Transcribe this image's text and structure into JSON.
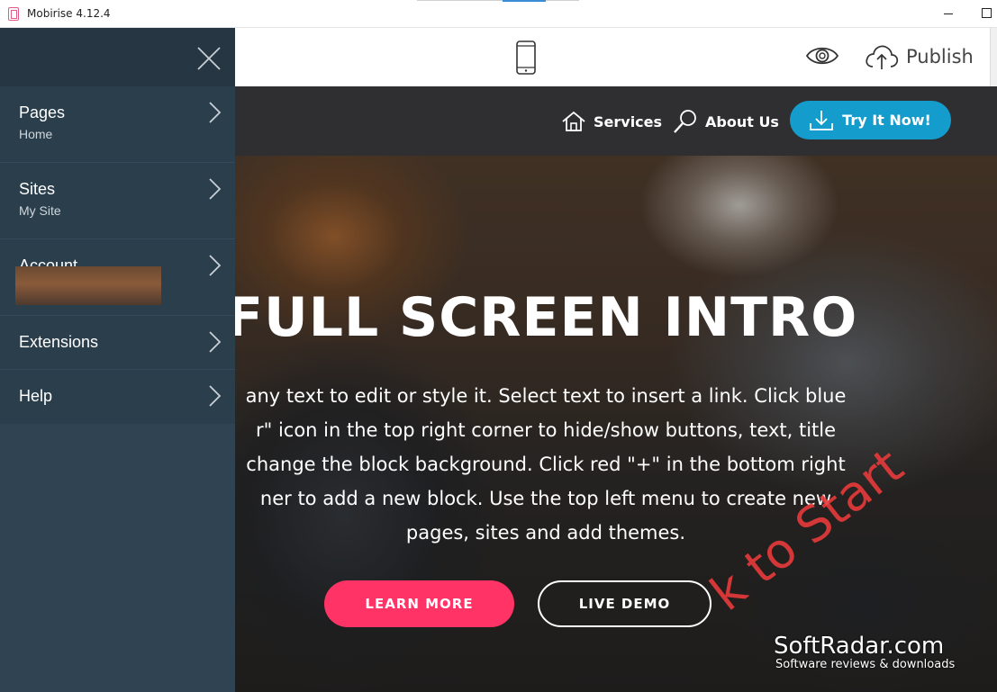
{
  "window": {
    "title": "Mobirise 4.12.4"
  },
  "toolbar": {
    "publish_label": "Publish"
  },
  "sidebar": {
    "items": [
      {
        "label": "Pages",
        "sub": "Home"
      },
      {
        "label": "Sites",
        "sub": "My Site"
      },
      {
        "label": "Account",
        "sub": ""
      },
      {
        "label": "Extensions",
        "sub": ""
      },
      {
        "label": "Help",
        "sub": ""
      }
    ]
  },
  "site": {
    "nav": {
      "services": "Services",
      "about": "About Us",
      "cta": "Try It Now!"
    },
    "hero": {
      "title": "FULL SCREEN INTRO",
      "text_lines": [
        "any text to edit or style it. Select text to insert a link. Click blue",
        "r\" icon in the top right corner to hide/show buttons, text, title",
        "change the block background. Click red \"+\" in the bottom right",
        "ner to add a new block. Use the top left menu to create new",
        "pages, sites and add themes."
      ],
      "learn_more": "LEARN MORE",
      "live_demo": "LIVE DEMO"
    }
  },
  "watermark": {
    "brand": "SoftRadar.com",
    "tagline": "Software reviews & downloads",
    "red_text": "k to Start"
  },
  "colors": {
    "cta_blue": "#149dcc",
    "learn_pink": "#ff3366",
    "sidebar": "#2b3e4c",
    "nav_bg": "#2f2f31"
  },
  "icons": [
    "close-icon",
    "chevron-right-icon",
    "phone-icon",
    "eye-icon",
    "cloud-upload-icon",
    "home-icon",
    "search-icon",
    "download-icon"
  ]
}
